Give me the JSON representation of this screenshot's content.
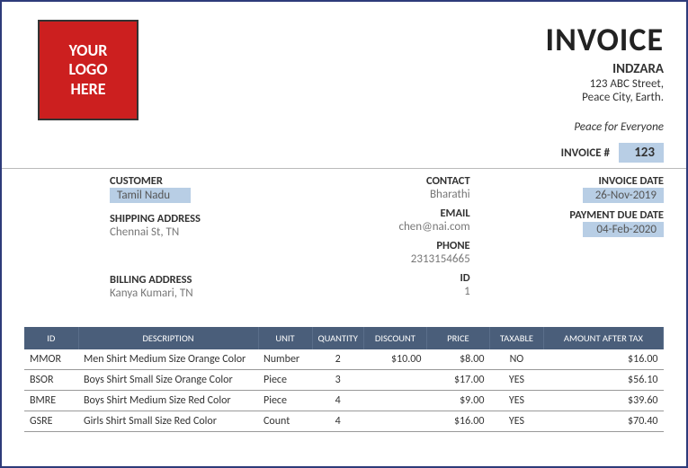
{
  "header": {
    "logo_line1": "YOUR",
    "logo_line2": "LOGO",
    "logo_line3": "HERE",
    "title": "INVOICE",
    "company": "INDZARA",
    "address1": "123 ABC Street,",
    "address2": "Peace City, Earth.",
    "tagline": "Peace for Everyone",
    "invoice_num_label": "INVOICE #",
    "invoice_num": "123"
  },
  "customer": {
    "customer_label": "CUSTOMER",
    "customer_value": "Tamil Nadu",
    "shipping_label": "SHIPPING ADDRESS",
    "shipping_value": "Chennai St, TN",
    "billing_label": "BILLING ADDRESS",
    "billing_value": "Kanya Kumari, TN"
  },
  "contact": {
    "contact_label": "CONTACT",
    "contact_value": "Bharathi",
    "email_label": "EMAIL",
    "email_value": "chen@nai.com",
    "phone_label": "PHONE",
    "phone_value": "2313154665",
    "id_label": "ID",
    "id_value": "1"
  },
  "dates": {
    "invoice_date_label": "INVOICE DATE",
    "invoice_date": "26-Nov-2019",
    "due_label": "PAYMENT DUE DATE",
    "due_date": "04-Feb-2020"
  },
  "table": {
    "headers": {
      "id": "ID",
      "desc": "DESCRIPTION",
      "unit": "UNIT",
      "qty": "QUANTITY",
      "disc": "DISCOUNT",
      "price": "PRICE",
      "tax": "TAXABLE",
      "amt": "AMOUNT AFTER TAX"
    },
    "rows": [
      {
        "id": "MMOR",
        "desc": "Men Shirt Medium Size Orange Color",
        "unit": "Number",
        "qty": "2",
        "disc": "$10.00",
        "price": "$8.00",
        "tax": "NO",
        "amt": "$16.00"
      },
      {
        "id": "BSOR",
        "desc": "Boys Shirt Small Size Orange Color",
        "unit": "Piece",
        "qty": "3",
        "disc": "",
        "price": "$17.00",
        "tax": "YES",
        "amt": "$56.10"
      },
      {
        "id": "BMRE",
        "desc": "Boys Shirt Medium Size Red Color",
        "unit": "Piece",
        "qty": "4",
        "disc": "",
        "price": "$9.00",
        "tax": "YES",
        "amt": "$39.60"
      },
      {
        "id": "GSRE",
        "desc": "Girls Shirt Small Size Red Color",
        "unit": "Count",
        "qty": "4",
        "disc": "",
        "price": "$16.00",
        "tax": "YES",
        "amt": "$70.40"
      }
    ]
  }
}
